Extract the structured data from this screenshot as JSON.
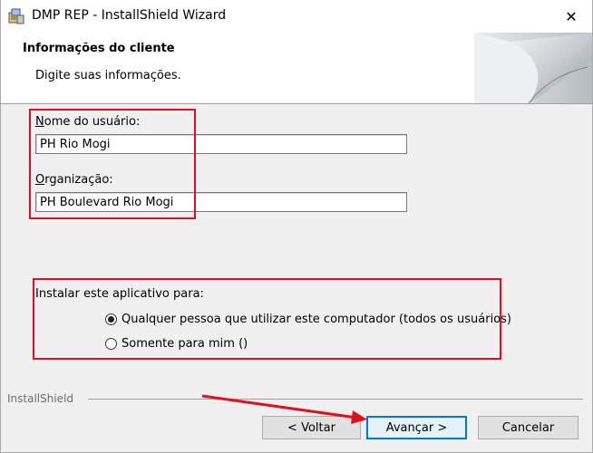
{
  "window": {
    "title": "DMP REP - InstallShield Wizard",
    "close_glyph": "✕"
  },
  "header": {
    "title": "Informações do cliente",
    "subtitle": "Digite suas informações."
  },
  "form": {
    "user_label_accel": "N",
    "user_label_rest": "ome do usuário:",
    "user_value": "PH Rio Mogi",
    "org_label_accel": "O",
    "org_label_rest": "rganização:",
    "org_value": "PH Boulevard Rio Mogi"
  },
  "install": {
    "label": "Instalar este aplicativo para:",
    "options": [
      {
        "label": "Qualquer pessoa que utilizar este computador (todos os usuários)",
        "selected": true
      },
      {
        "label": "Somente para mim ()",
        "selected": false
      }
    ]
  },
  "footer": {
    "brand": "InstallShield",
    "back_label": "< Voltar",
    "next_label": "Avançar >",
    "cancel_label": "Cancelar"
  },
  "colors": {
    "highlight": "#e0101e",
    "default_button_border": "#0078d7"
  },
  "icons": {
    "app": "installer-icon",
    "close": "close-icon",
    "banner": "curled-page-graphic",
    "annotation": "red-arrow"
  }
}
